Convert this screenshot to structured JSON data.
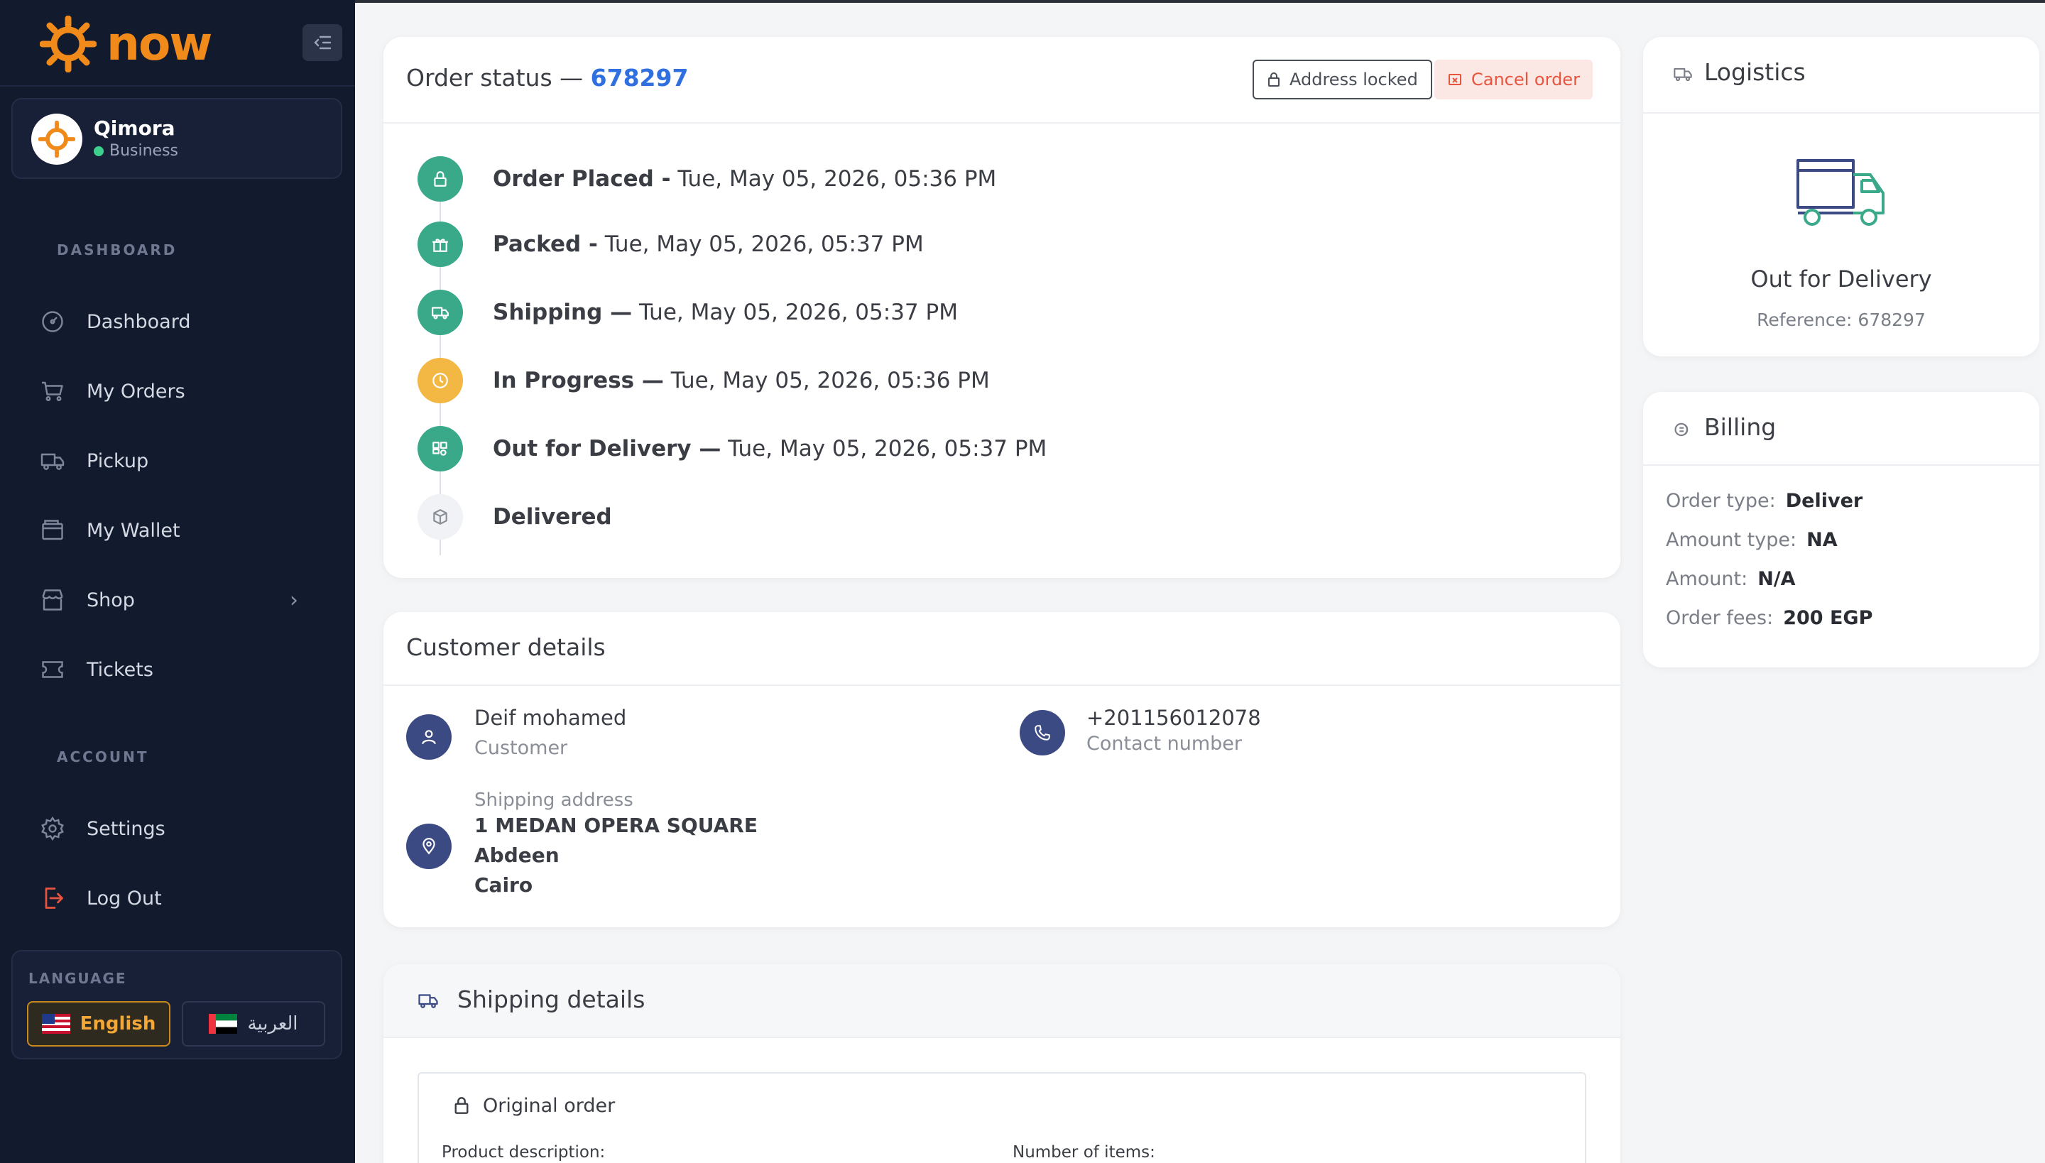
{
  "brand": {
    "name": "now",
    "accent": "#f08a1a"
  },
  "sidebar": {
    "profile": {
      "name": "Qimora",
      "role": "Business",
      "status_color": "#3ecf8e"
    },
    "sections": {
      "dashboard": "DASHBOARD",
      "account": "ACCOUNT",
      "language": "LANGUAGE"
    },
    "items": [
      {
        "label": "Dashboard",
        "icon": "gauge-icon"
      },
      {
        "label": "My Orders",
        "icon": "cart-icon"
      },
      {
        "label": "Pickup",
        "icon": "truck-icon"
      },
      {
        "label": "My Wallet",
        "icon": "wallet-icon"
      },
      {
        "label": "Shop",
        "icon": "store-icon"
      },
      {
        "label": "Tickets",
        "icon": "ticket-icon"
      }
    ],
    "account_items": [
      {
        "label": "Settings",
        "icon": "gear-icon"
      },
      {
        "label": "Log Out",
        "icon": "logout-icon"
      }
    ],
    "languages": {
      "english": "English",
      "arabic": "العربية"
    }
  },
  "order_status": {
    "title_prefix": "Order status —",
    "order_id": "678297",
    "address_locked_label": "Address locked",
    "cancel_label": "Cancel order",
    "timeline": [
      {
        "label": "Order Placed -",
        "time": "Tue, May 05, 2026, 05:36 PM",
        "state": "done",
        "icon": "lock-icon"
      },
      {
        "label": "Packed -",
        "time": "Tue, May 05, 2026, 05:37 PM",
        "state": "done",
        "icon": "gift-icon"
      },
      {
        "label": "Shipping —",
        "time": "Tue, May 05, 2026, 05:37 PM",
        "state": "done",
        "icon": "truck-icon"
      },
      {
        "label": "In Progress —",
        "time": "Tue, May 05, 2026, 05:36 PM",
        "state": "active",
        "icon": "clock-icon"
      },
      {
        "label": "Out for Delivery —",
        "time": "Tue, May 05, 2026, 05:37 PM",
        "state": "done",
        "icon": "delivery-icon"
      },
      {
        "label": "Delivered",
        "time": "",
        "state": "pending",
        "icon": "box-icon"
      }
    ],
    "colors": {
      "done": "#3aa98a",
      "active": "#f3b843",
      "pending": "#f1f2f5"
    }
  },
  "customer": {
    "title": "Customer details",
    "name": "Deif mohamed",
    "name_caption": "Customer",
    "phone": "+201156012078",
    "phone_caption": "Contact number",
    "address_caption": "Shipping address",
    "address_lines": [
      "1 MEDAN OPERA SQUARE",
      "Abdeen",
      "Cairo"
    ]
  },
  "shipping": {
    "title": "Shipping details",
    "original_order": "Original order",
    "product_description_label": "Product description:",
    "number_of_items_label": "Number of items:"
  },
  "logistics": {
    "title": "Logistics",
    "status": "Out for Delivery",
    "reference_label": "Reference:",
    "reference": "678297"
  },
  "billing": {
    "title": "Billing",
    "rows": [
      {
        "label": "Order type:",
        "value": "Deliver"
      },
      {
        "label": "Amount type:",
        "value": "NA"
      },
      {
        "label": "Amount:",
        "value": "N/A"
      },
      {
        "label": "Order fees:",
        "value": "200 EGP"
      }
    ]
  }
}
